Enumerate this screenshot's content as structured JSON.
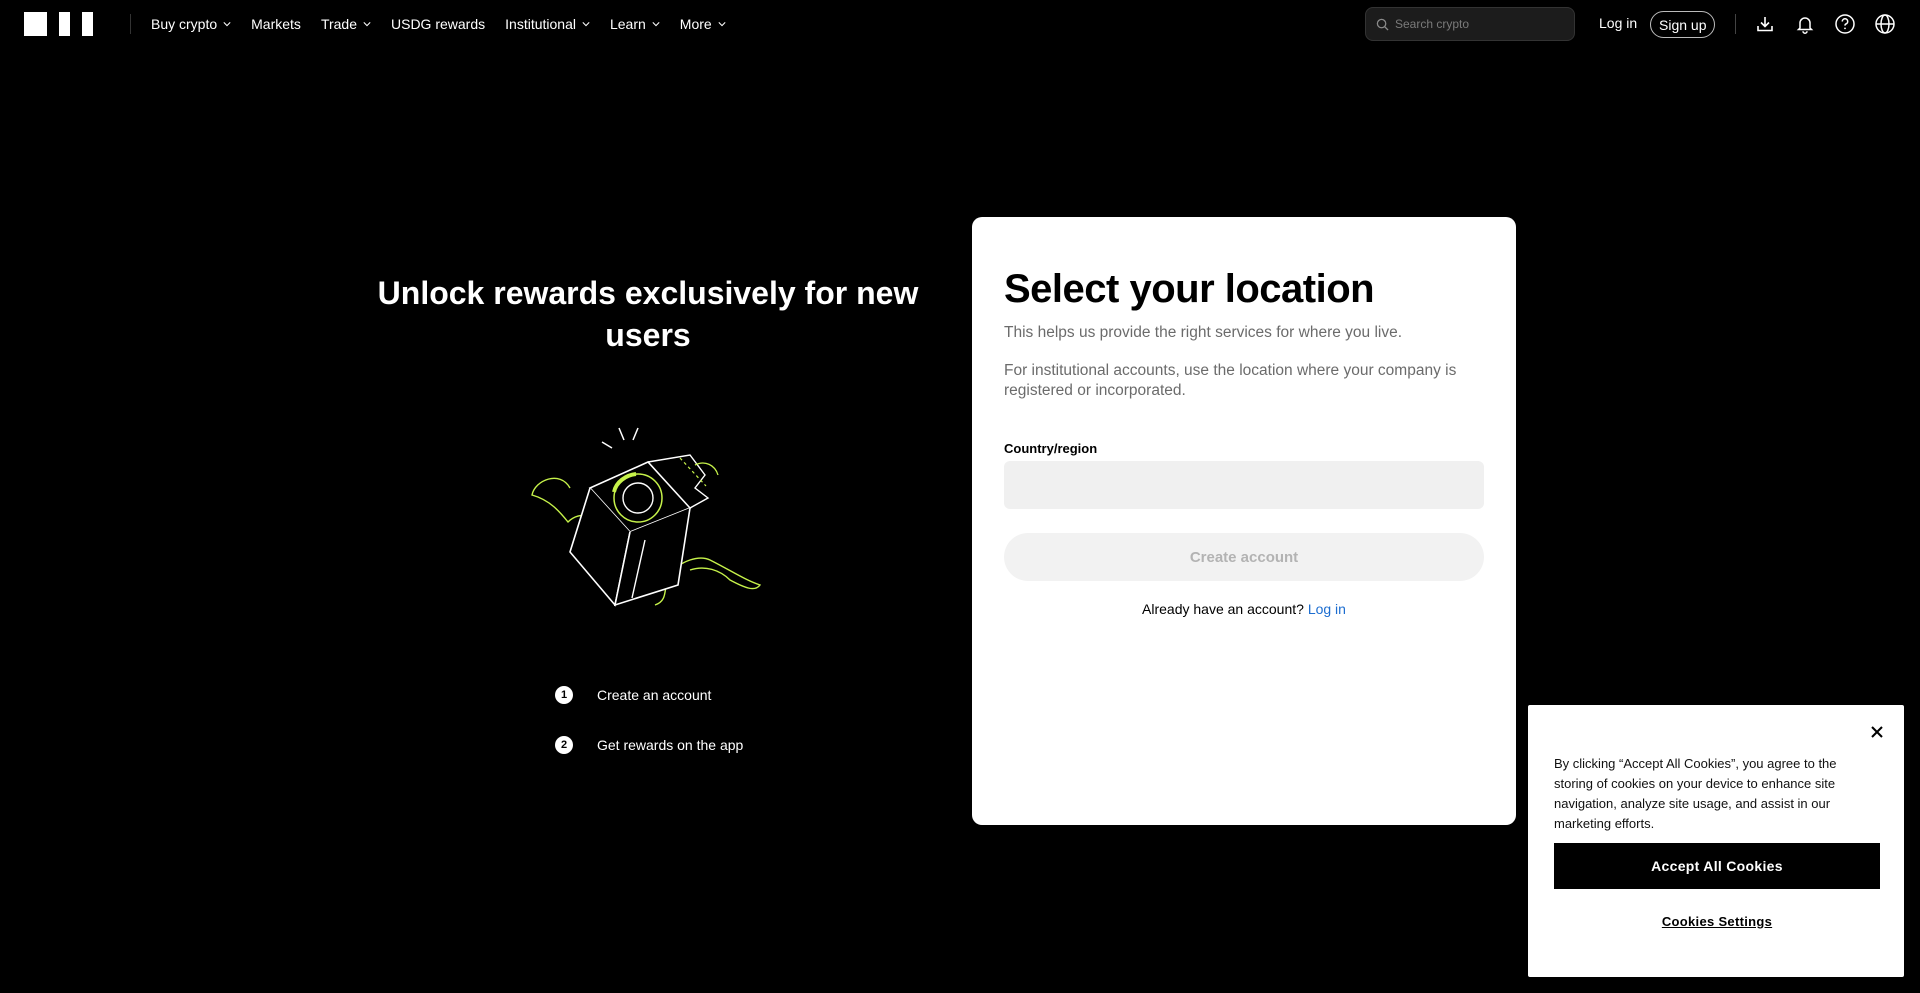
{
  "brand": {
    "logo_name": "okx-logo"
  },
  "nav": {
    "items": [
      {
        "label": "Buy crypto",
        "has_dropdown": true
      },
      {
        "label": "Markets",
        "has_dropdown": false
      },
      {
        "label": "Trade",
        "has_dropdown": true
      },
      {
        "label": "USDG rewards",
        "has_dropdown": false
      },
      {
        "label": "Institutional",
        "has_dropdown": true
      },
      {
        "label": "Learn",
        "has_dropdown": true
      },
      {
        "label": "More",
        "has_dropdown": true
      }
    ]
  },
  "search": {
    "placeholder": "Search crypto",
    "value": "",
    "icon": "search-icon"
  },
  "header_actions": {
    "login_label": "Log in",
    "signup_label": "Sign up",
    "icons": [
      "download-icon",
      "bell-icon",
      "help-icon",
      "globe-icon"
    ]
  },
  "promo": {
    "title": "Unlock rewards exclusively for new users",
    "illustration": "gift-box-illustration",
    "steps": [
      {
        "num": "1",
        "label": "Create an account"
      },
      {
        "num": "2",
        "label": "Get rewards on the app"
      }
    ]
  },
  "location_card": {
    "title": "Select your location",
    "subtitle": "This helps us provide the right services for where you live.",
    "institutional_note": "For institutional accounts, use the location where your company is registered or incorporated.",
    "country_label": "Country/region",
    "country_value": "",
    "create_button": "Create account",
    "already_text": "Already have an account?",
    "login_link": "Log in"
  },
  "cookie_banner": {
    "text": "By clicking “Accept All Cookies”, you agree to the storing of cookies on your device to enhance site navigation, analyze site usage, and assist in our marketing efforts.",
    "accept_label": "Accept All Cookies",
    "settings_label": "Cookies Settings"
  },
  "colors": {
    "background": "#000000",
    "card": "#ffffff",
    "link": "#1c6dd0",
    "accent_lime": "#c6f24a",
    "disabled_button_text": "#b3b3b3"
  }
}
